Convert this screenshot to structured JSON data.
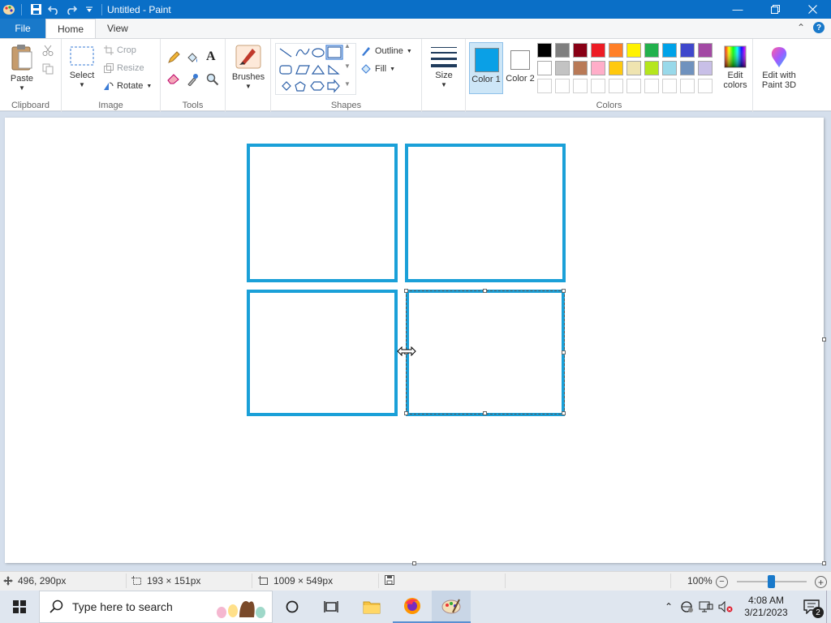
{
  "titlebar": {
    "title": "Untitled - Paint",
    "quick_access": [
      "paint-app-icon",
      "save-icon",
      "undo-icon",
      "redo-icon",
      "customize-dropdown-icon"
    ],
    "controls": [
      "minimize-icon",
      "restore-icon",
      "close-icon"
    ]
  },
  "tabs": {
    "file": "File",
    "home": "Home",
    "view": "View",
    "active": "Home"
  },
  "ribbon": {
    "clipboard": {
      "label": "Clipboard",
      "paste": "Paste"
    },
    "image": {
      "label": "Image",
      "select": "Select",
      "crop": "Crop",
      "resize": "Resize",
      "rotate": "Rotate"
    },
    "tools": {
      "label": "Tools"
    },
    "brushes": {
      "label": "Brushes"
    },
    "shapes": {
      "label": "Shapes",
      "outline": "Outline",
      "fill": "Fill"
    },
    "size": {
      "label": "Size"
    },
    "color1": {
      "label": "Color 1",
      "value": "#0aa0e6"
    },
    "color2": {
      "label": "Color 2",
      "value": "#ffffff"
    },
    "colors": {
      "label": "Colors",
      "row1": [
        "#000000",
        "#7f7f7f",
        "#880015",
        "#ed1c24",
        "#ff7f27",
        "#fff200",
        "#22b14c",
        "#00a2e8",
        "#3f48cc",
        "#a349a4"
      ],
      "row2": [
        "#ffffff",
        "#c3c3c3",
        "#b97a57",
        "#ffaec9",
        "#ffc90e",
        "#efe4b0",
        "#b5e61d",
        "#99d9ea",
        "#7092be",
        "#c8bfe7"
      ],
      "row3": [
        "#ffffff",
        "#ffffff",
        "#ffffff",
        "#ffffff",
        "#ffffff",
        "#ffffff",
        "#ffffff",
        "#ffffff",
        "#ffffff",
        "#ffffff"
      ]
    },
    "edit_colors": "Edit colors",
    "edit_with_3d": "Edit with Paint 3D"
  },
  "canvas": {
    "stroke_color": "#1aa0d8"
  },
  "statusbar": {
    "cursor_pos": "496, 290px",
    "selection_size": "193 × 151px",
    "canvas_size": "1009 × 549px",
    "zoom": "100%"
  },
  "taskbar": {
    "search_placeholder": "Type here to search",
    "time": "4:08 AM",
    "date": "3/21/2023",
    "notification_count": "2"
  }
}
